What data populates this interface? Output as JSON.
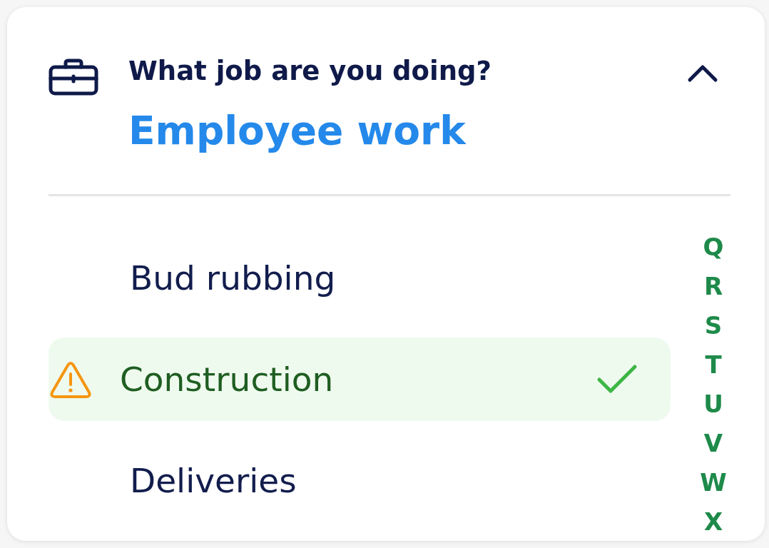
{
  "question": {
    "title": "What job are you doing?",
    "answer": "Employee work",
    "expanded": true
  },
  "options": [
    {
      "label": "Bud rubbing",
      "selected": false,
      "warning": false
    },
    {
      "label": "Construction",
      "selected": true,
      "warning": true
    },
    {
      "label": "Deliveries",
      "selected": false,
      "warning": false
    }
  ],
  "alphabet_index": [
    "Q",
    "R",
    "S",
    "T",
    "U",
    "V",
    "W",
    "X"
  ]
}
